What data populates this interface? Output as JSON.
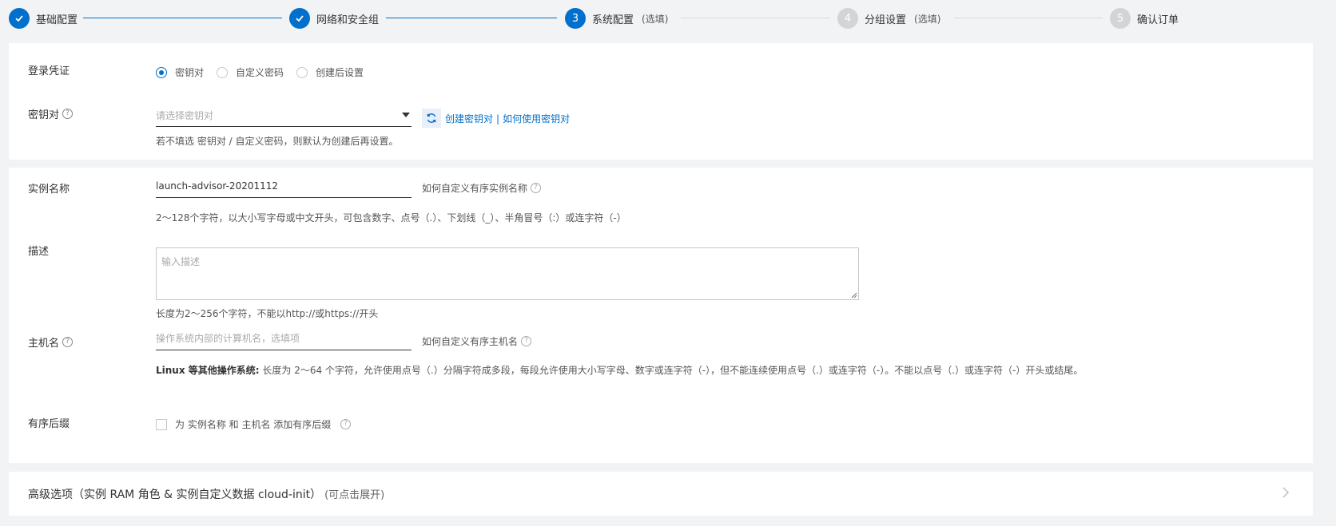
{
  "steps": [
    {
      "num": "1",
      "label": "基础配置",
      "optional": "",
      "state": "done"
    },
    {
      "num": "2",
      "label": "网络和安全组",
      "optional": "",
      "state": "done"
    },
    {
      "num": "3",
      "label": "系统配置",
      "optional": "(选填)",
      "state": "active"
    },
    {
      "num": "4",
      "label": "分组设置",
      "optional": "(选填)",
      "state": "todo"
    },
    {
      "num": "5",
      "label": "确认订单",
      "optional": "",
      "state": "todo"
    }
  ],
  "login": {
    "label": "登录凭证",
    "options": [
      "密钥对",
      "自定义密码",
      "创建后设置"
    ],
    "selected": "密钥对"
  },
  "keypair": {
    "label": "密钥对",
    "placeholder": "请选择密钥对",
    "create_link": "创建密钥对",
    "separator": "|",
    "howto_link": "如何使用密钥对",
    "hint": "若不填选 密钥对 / 自定义密码，则默认为创建后再设置。"
  },
  "instance_name": {
    "label": "实例名称",
    "value": "launch-advisor-20201112",
    "side_link": "如何自定义有序实例名称",
    "hint": "2～128个字符，以大小写字母或中文开头，可包含数字、点号（.）、下划线（_）、半角冒号（:）或连字符（-）"
  },
  "description": {
    "label": "描述",
    "placeholder": "输入描述",
    "hint": "长度为2～256个字符，不能以http://或https://开头"
  },
  "hostname": {
    "label": "主机名",
    "placeholder": "操作系统内部的计算机名，选填项",
    "side_link": "如何自定义有序主机名",
    "hint_bold": "Linux 等其他操作系统:",
    "hint": " 长度为 2～64 个字符，允许使用点号（.）分隔字符成多段，每段允许使用大小写字母、数字或连字符（-），但不能连续使用点号（.）或连字符（-）。不能以点号（.）或连字符（-）开头或结尾。"
  },
  "suffix": {
    "label": "有序后缀",
    "checkbox_text": "为 实例名称 和 主机名 添加有序后缀"
  },
  "advanced": {
    "title": "高级选项（实例 RAM 角色 & 实例自定义数据 cloud-init）",
    "subtitle": "(可点击展开)"
  },
  "colors": {
    "accent": "#0070cc",
    "inactive_step": "#d4d4d4",
    "background": "#f2f3f5"
  }
}
